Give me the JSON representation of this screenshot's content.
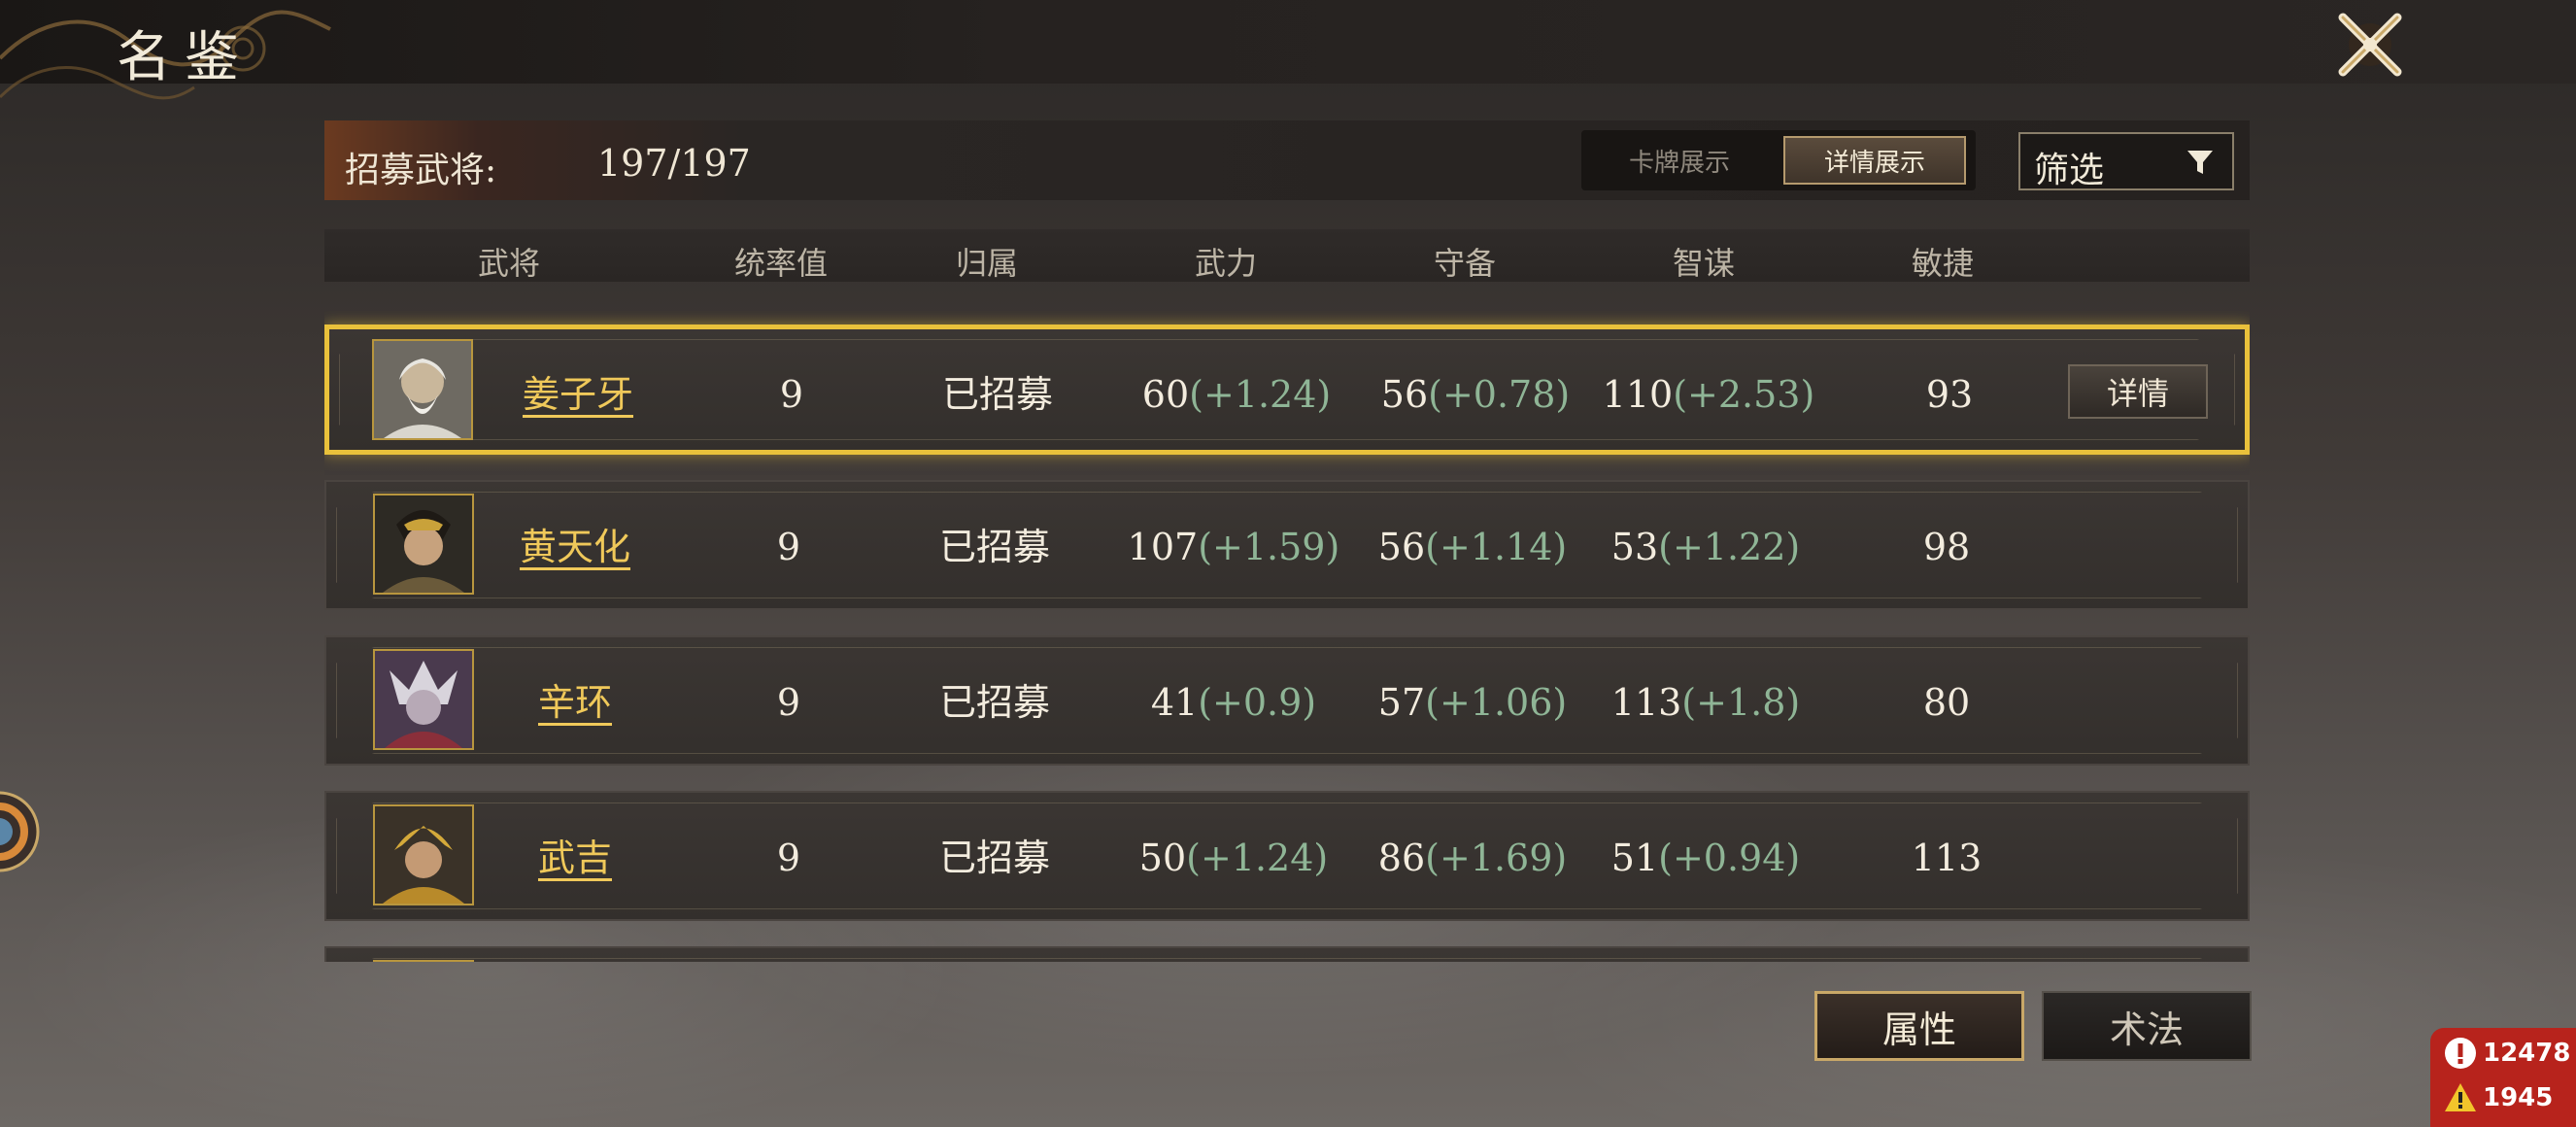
{
  "header": {
    "title": "名鉴",
    "recruit_label": "招募武将:",
    "recruit_count": "197/197",
    "view_card_label": "卡牌展示",
    "view_detail_label": "详情展示",
    "filter_label": "筛选"
  },
  "columns": [
    "武将",
    "统率值",
    "归属",
    "武力",
    "守备",
    "智谋",
    "敏捷"
  ],
  "rows": [
    {
      "name": "姜子牙",
      "leadership": "9",
      "status": "已招募",
      "force": "60",
      "force_bonus": "(+1.24)",
      "defense": "56",
      "defense_bonus": "(+0.78)",
      "intellect": "110",
      "intellect_bonus": "(+2.53)",
      "agility": "93",
      "detail_label": "详情"
    },
    {
      "name": "黄天化",
      "leadership": "9",
      "status": "已招募",
      "force": "107",
      "force_bonus": "(+1.59)",
      "defense": "56",
      "defense_bonus": "(+1.14)",
      "intellect": "53",
      "intellect_bonus": "(+1.22)",
      "agility": "98"
    },
    {
      "name": "辛环",
      "leadership": "9",
      "status": "已招募",
      "force": "41",
      "force_bonus": "(+0.9)",
      "defense": "57",
      "defense_bonus": "(+1.06)",
      "intellect": "113",
      "intellect_bonus": "(+1.8)",
      "agility": "80"
    },
    {
      "name": "武吉",
      "leadership": "9",
      "status": "已招募",
      "force": "50",
      "force_bonus": "(+1.24)",
      "defense": "86",
      "defense_bonus": "(+1.69)",
      "intellect": "51",
      "intellect_bonus": "(+0.94)",
      "agility": "113"
    }
  ],
  "tabs": {
    "attributes": "属性",
    "skills": "术法"
  },
  "notifications": {
    "errors": "12478",
    "warnings": "1945"
  },
  "colors": {
    "name_gold": "#f0c95a",
    "bonus_green": "#8fb596",
    "selected_border": "#e9c13b",
    "notif_red": "#b7231c"
  },
  "icons": [
    "close-icon",
    "filter-icon",
    "error-icon",
    "warning-icon",
    "avatar-portrait"
  ]
}
